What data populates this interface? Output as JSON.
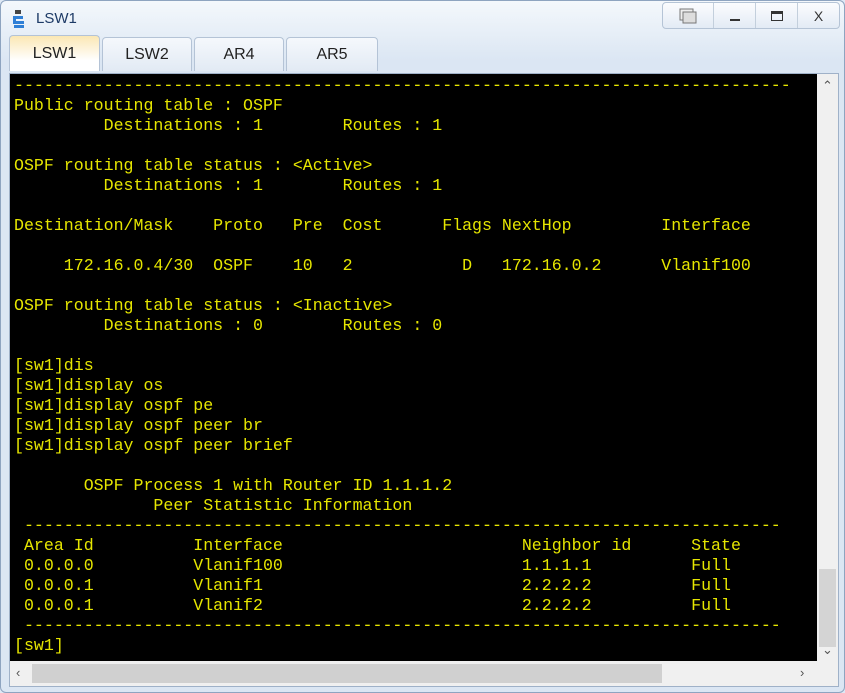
{
  "window": {
    "title": "LSW1",
    "controls": [
      "restore-all",
      "minimize",
      "maximize",
      "close"
    ],
    "close_label": "X"
  },
  "tabs": [
    {
      "label": "LSW1",
      "active": true
    },
    {
      "label": "LSW2"
    },
    {
      "label": "AR4"
    },
    {
      "label": "AR5"
    }
  ],
  "terminal": {
    "text_color": "#e6e600",
    "lines": [
      "------------------------------------------------------------------------------",
      "Public routing table : OSPF",
      "         Destinations : 1        Routes : 1",
      "",
      "OSPF routing table status : <Active>",
      "         Destinations : 1        Routes : 1",
      "",
      "Destination/Mask    Proto   Pre  Cost      Flags NextHop         Interface",
      "",
      "     172.16.0.4/30  OSPF    10   2           D   172.16.0.2      Vlanif100",
      "",
      "OSPF routing table status : <Inactive>",
      "         Destinations : 0        Routes : 0",
      "",
      "[sw1]dis",
      "[sw1]display os",
      "[sw1]display ospf pe",
      "[sw1]display ospf peer br",
      "[sw1]display ospf peer brief",
      "",
      "       OSPF Process 1 with Router ID 1.1.1.2",
      "              Peer Statistic Information",
      " ----------------------------------------------------------------------------",
      " Area Id          Interface                        Neighbor id      State",
      " 0.0.0.0          Vlanif100                        1.1.1.1          Full",
      " 0.0.0.1          Vlanif1                          2.2.2.2          Full",
      " 0.0.0.1          Vlanif2                          2.2.2.2          Full",
      " ----------------------------------------------------------------------------",
      "[sw1]"
    ]
  }
}
